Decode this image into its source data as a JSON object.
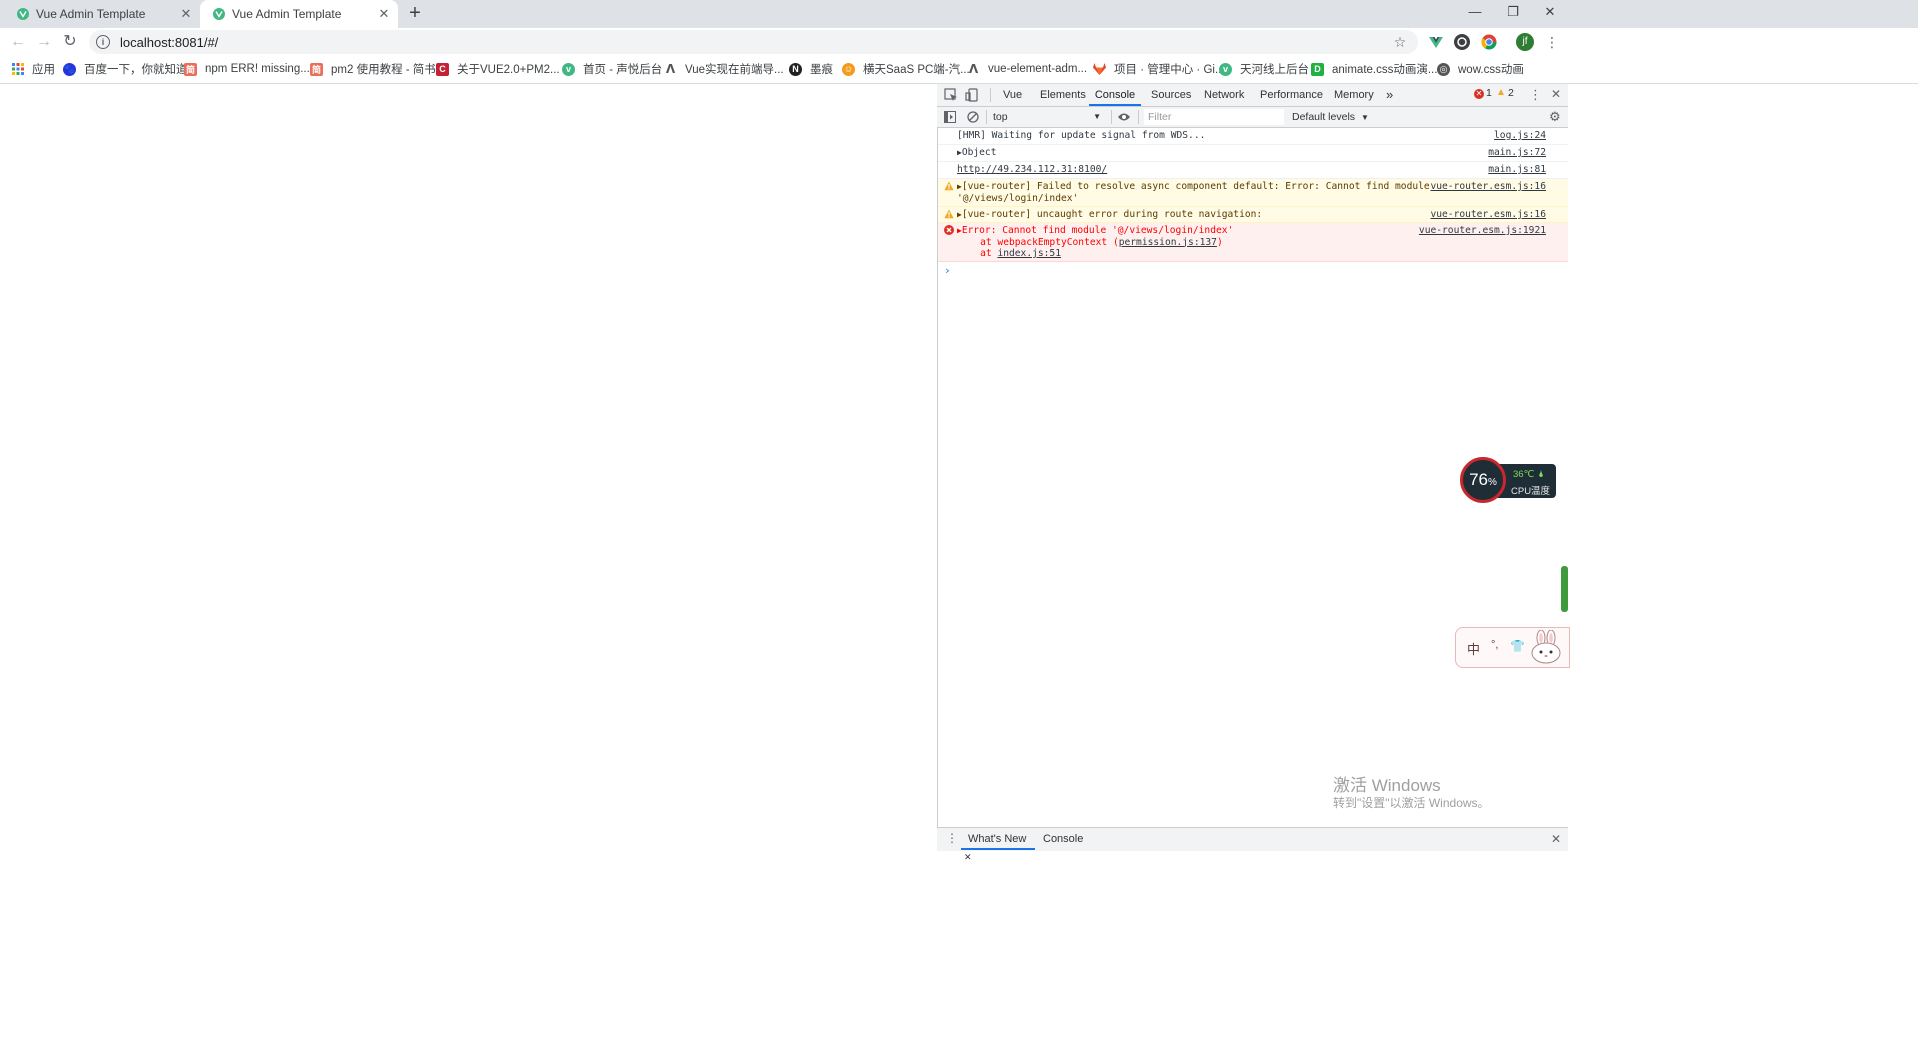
{
  "browser": {
    "tabs": [
      {
        "title": "Vue Admin Template",
        "active": false
      },
      {
        "title": "Vue Admin Template",
        "active": true
      }
    ],
    "new_tab_symbol": "+",
    "window_controls": {
      "minimize": "—",
      "restore": "❐",
      "close": "✕"
    },
    "url": "localhost:8081/#/",
    "profile_initial": "jf"
  },
  "bookmarks": [
    {
      "label": "应用",
      "icon": "apps-grid-icon",
      "color": "#4285f4"
    },
    {
      "label": "百度一下，你就知道",
      "icon": "baidu-icon",
      "color": "#2932e1"
    },
    {
      "label": "npm ERR! missing...",
      "icon": "jianshu-icon",
      "color": "#ea6f5a"
    },
    {
      "label": "pm2 使用教程 - 简书",
      "icon": "jianshu-icon",
      "color": "#ea6f5a"
    },
    {
      "label": "关于VUE2.0+PM2...",
      "icon": "csdn-icon",
      "color": "#c32136"
    },
    {
      "label": "首页 - 声悦后台",
      "icon": "vue-icon",
      "color": "#41b883"
    },
    {
      "label": "Vue实现在前端导...",
      "icon": "link-icon",
      "color": "#555555"
    },
    {
      "label": "墨痕",
      "icon": "moheng-icon",
      "color": "#222222"
    },
    {
      "label": "横天SaaS PC端-汽...",
      "icon": "saas-icon",
      "color": "#f29b1c"
    },
    {
      "label": "vue-element-adm...",
      "icon": "link-icon",
      "color": "#555555"
    },
    {
      "label": "项目 · 管理中心 · Gi...",
      "icon": "gitlab-icon",
      "color": "#e24329"
    },
    {
      "label": "天河线上后台",
      "icon": "vue-icon",
      "color": "#41b883"
    },
    {
      "label": "animate.css动画演...",
      "icon": "d-icon",
      "color": "#1fb141"
    },
    {
      "label": "wow.css动画",
      "icon": "globe-icon",
      "color": "#555555"
    }
  ],
  "devtools": {
    "tabs": [
      "Vue",
      "Elements",
      "Console",
      "Sources",
      "Network",
      "Performance",
      "Memory"
    ],
    "active_tab": "Console",
    "more_tabs": "»",
    "error_count": "1",
    "warning_count": "2",
    "context": "top",
    "filter_placeholder": "Filter",
    "levels": "Default levels",
    "messages": [
      {
        "level": "log",
        "text": "[HMR] Waiting for update signal from WDS...",
        "source": "log.js:24"
      },
      {
        "level": "log",
        "text": "Object",
        "source": "main.js:72",
        "expandable": true
      },
      {
        "level": "log",
        "text": "http://49.234.112.31:8100/",
        "source": "main.js:81",
        "is_link": true
      },
      {
        "level": "warning",
        "text": "[vue-router] Failed to resolve async component default: Error: Cannot find module",
        "text2": "'@/views/login/index'",
        "source": "vue-router.esm.js:16",
        "expandable": true
      },
      {
        "level": "warning",
        "text": "[vue-router] uncaught error during route navigation:",
        "source": "vue-router.esm.js:16",
        "expandable": true
      },
      {
        "level": "error",
        "text": "Error: Cannot find module '@/views/login/index'",
        "stack1_prefix": "    at webpackEmptyContext (",
        "stack1_link": "permission.js:137",
        "stack1_suffix": ")",
        "stack2_prefix": "    at ",
        "stack2_link": "index.js:51",
        "source": "vue-router.esm.js:1921",
        "expandable": true
      }
    ],
    "prompt": "›",
    "drawer_tabs": [
      "What's New",
      "Console"
    ],
    "drawer_active": "What's New"
  },
  "overlays": {
    "cpu_percent": "76",
    "cpu_percent_unit": "%",
    "cpu_temp": "36℃",
    "cpu_label": "CPU温度",
    "ime_items": [
      "中",
      "°,",
      "👕"
    ],
    "watermark_title": "激活 Windows",
    "watermark_sub": "转到\"设置\"以激活 Windows。"
  },
  "colors": {
    "tab_strip": "#dee1e6",
    "accent_blue": "#1a73e8",
    "error_red": "#ff0000",
    "warning_yellow": "#f5a623",
    "vue_green": "#41b883"
  }
}
